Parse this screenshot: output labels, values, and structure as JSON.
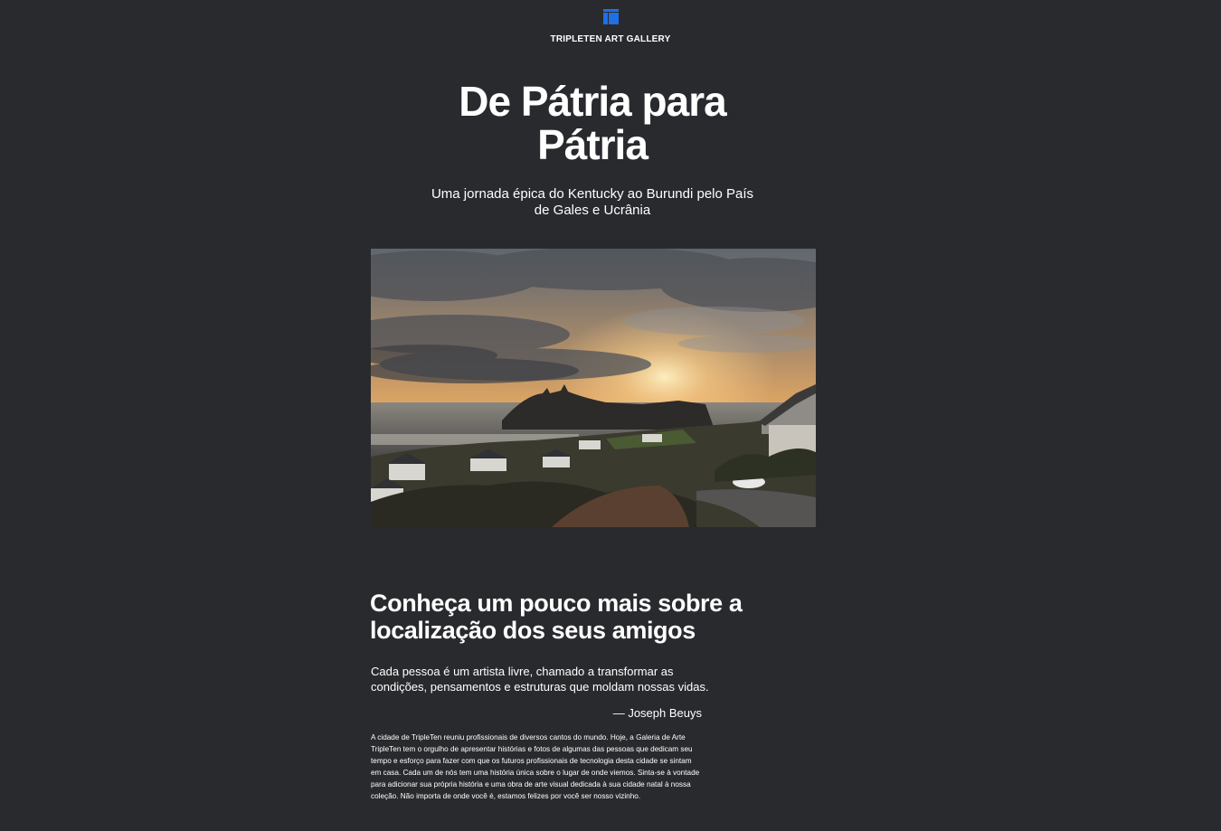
{
  "header": {
    "logo_icon": "gallery-logo-icon",
    "brand": "TRIPLETEN ART GALLERY",
    "accent_color": "#1f6fe5"
  },
  "hero": {
    "title": "De Pátria para Pátria",
    "subtitle": "Uma jornada épica do Kentucky ao Burundi pelo País de Gales e Ucrânia"
  },
  "section": {
    "title": "Conheça um pouco mais sobre a localização dos seus amigos",
    "quote": "Cada pessoa é um artista livre, chamado a transformar as condições, pensamentos e estruturas que moldam nossas vidas.",
    "quote_author": "— Joseph Beuys",
    "body": "A cidade de TripleTen reuniu profissionais de diversos cantos do mundo. Hoje, a Galeria de Arte TripleTen tem o orgulho de apresentar histórias e fotos de algumas das pessoas que dedicam seu tempo e esforço para fazer com que os futuros profissionais de tecnologia desta cidade se sintam em casa. Cada um de nós tem uma história única sobre o lugar de onde viemos. Sinta-se à vontade para adicionar sua própria história e uma obra de arte visual dedicada à sua cidade natal à nossa coleção. Não importa de onde você é, estamos felizes por você ser nosso vizinho."
  },
  "colors": {
    "background": "#292a2d",
    "text": "#ffffff"
  }
}
